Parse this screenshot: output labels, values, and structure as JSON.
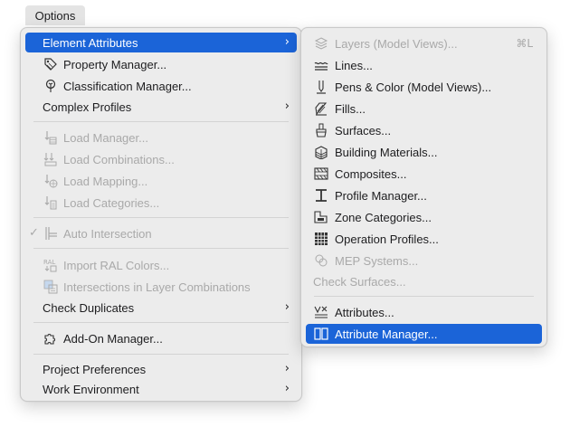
{
  "menubar": {
    "options_label": "Options"
  },
  "main_menu": {
    "element_attributes": "Element Attributes",
    "property_manager": "Property Manager...",
    "classification_manager": "Classification Manager...",
    "complex_profiles": "Complex Profiles",
    "load_manager": "Load Manager...",
    "load_combinations": "Load Combinations...",
    "load_mapping": "Load Mapping...",
    "load_categories": "Load Categories...",
    "auto_intersection": "Auto Intersection",
    "import_ral_colors": "Import RAL Colors...",
    "intersections_layer_combinations": "Intersections in Layer Combinations",
    "check_duplicates": "Check Duplicates",
    "add_on_manager": "Add-On Manager...",
    "project_preferences": "Project Preferences",
    "work_environment": "Work Environment",
    "submenu_arrow": "›",
    "check_mark": "✓",
    "ral_badge": "RAL"
  },
  "sub_menu": {
    "layers": "Layers (Model Views)...",
    "layers_shortcut": "⌘L",
    "lines": "Lines...",
    "pens_color": "Pens & Color (Model Views)...",
    "fills": "Fills...",
    "surfaces": "Surfaces...",
    "building_materials": "Building Materials...",
    "composites": "Composites...",
    "profile_manager": "Profile Manager...",
    "zone_categories": "Zone Categories...",
    "operation_profiles": "Operation Profiles...",
    "mep_systems": "MEP Systems...",
    "check_surfaces": "Check Surfaces...",
    "attributes": "Attributes...",
    "attribute_manager": "Attribute Manager..."
  },
  "colors": {
    "highlight": "#1b64d8",
    "disabled": "#a9a9a9",
    "menu_bg": "#ececec"
  }
}
